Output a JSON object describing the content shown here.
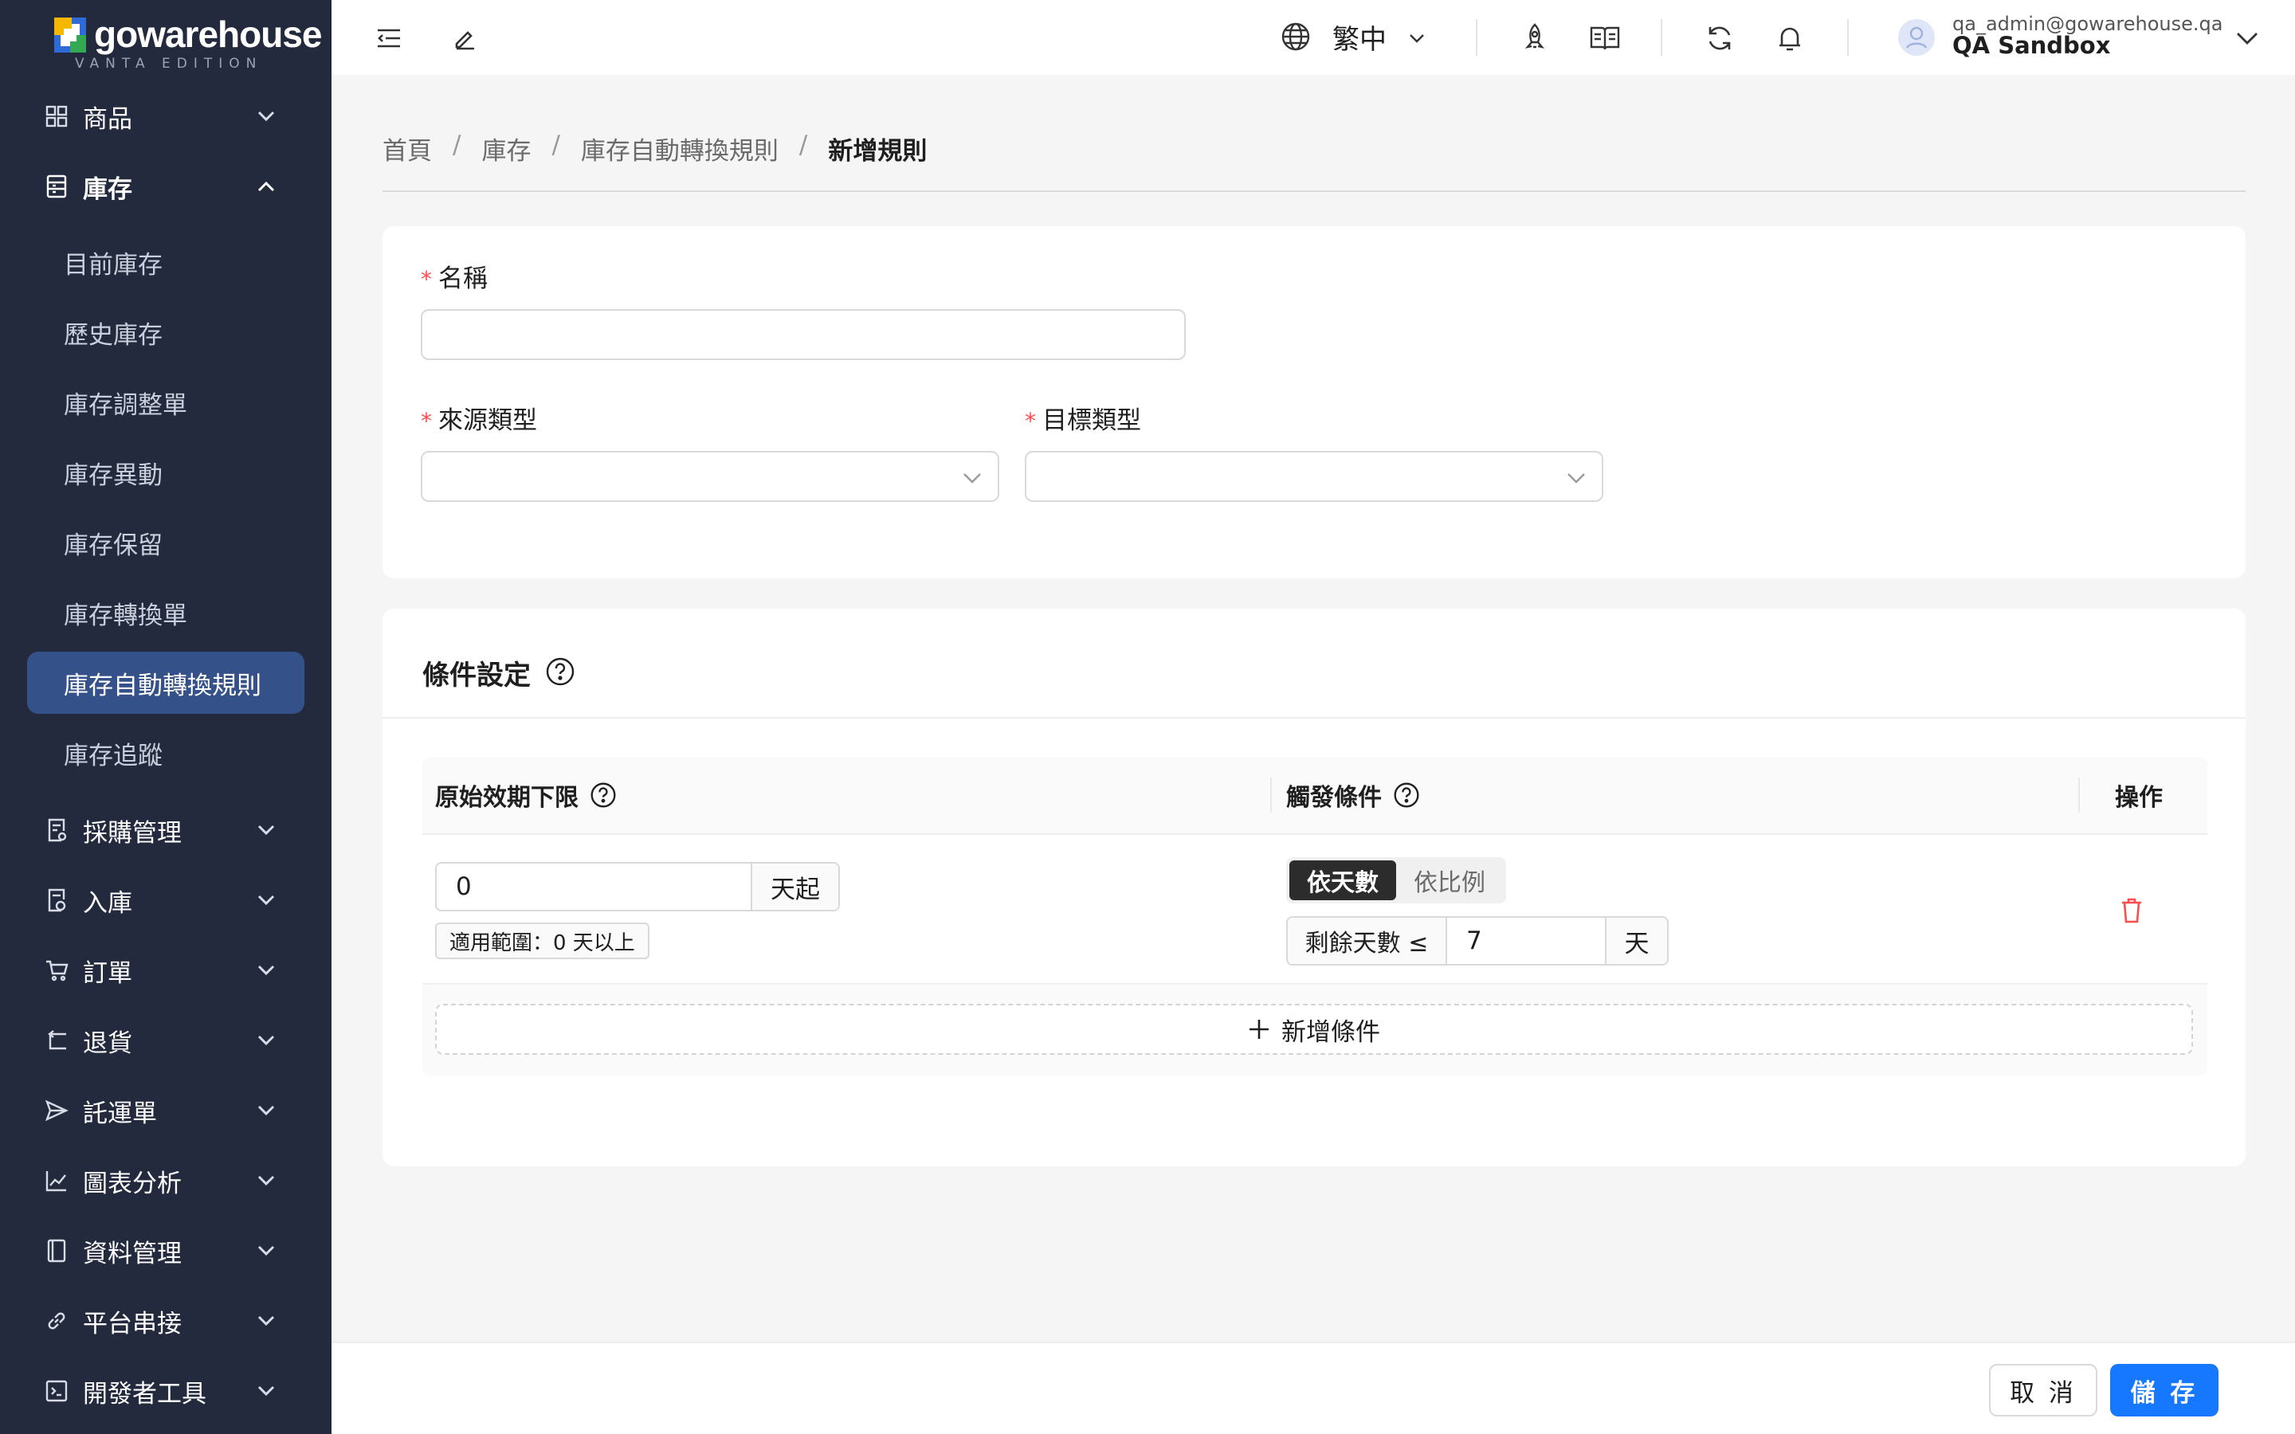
{
  "brand": {
    "name": "gowarehouse",
    "edition": "VANTA EDITION"
  },
  "sidebar": {
    "items": [
      {
        "label": "商品"
      },
      {
        "label": "庫存"
      },
      {
        "label": "採購管理"
      },
      {
        "label": "入庫"
      },
      {
        "label": "訂單"
      },
      {
        "label": "退貨"
      },
      {
        "label": "託運單"
      },
      {
        "label": "圖表分析"
      },
      {
        "label": "資料管理"
      },
      {
        "label": "平台串接"
      },
      {
        "label": "開發者工具"
      }
    ],
    "inventory_sub": [
      {
        "label": "目前庫存"
      },
      {
        "label": "歷史庫存"
      },
      {
        "label": "庫存調整單"
      },
      {
        "label": "庫存異動"
      },
      {
        "label": "庫存保留"
      },
      {
        "label": "庫存轉換單"
      },
      {
        "label": "庫存自動轉換規則"
      },
      {
        "label": "庫存追蹤"
      }
    ]
  },
  "header": {
    "language": "繁中",
    "user_email": "qa_admin@gowarehouse.qa",
    "user_name": "QA Sandbox"
  },
  "breadcrumb": [
    "首頁",
    "庫存",
    "庫存自動轉換規則",
    "新增規則"
  ],
  "form": {
    "name_label": "名稱",
    "name_value": "",
    "source_type_label": "來源類型",
    "target_type_label": "目標類型"
  },
  "conditions": {
    "title": "條件設定",
    "col_expiry": "原始效期下限",
    "col_trigger": "觸發條件",
    "col_action": "操作",
    "expiry_value": "0",
    "expiry_suffix": "天起",
    "range_tag": "適用範圍：0 天以上",
    "mode_days": "依天數",
    "mode_ratio": "依比例",
    "remaining_prefix": "剩餘天數 ≤",
    "remaining_value": "7",
    "remaining_suffix": "天",
    "add_condition": "新增條件"
  },
  "footer": {
    "cancel": "取 消",
    "save": "儲 存"
  },
  "colors": {
    "sidebar_bg": "#232a3d",
    "active_item": "#34518a",
    "primary": "#1677ff",
    "danger": "#ff4d4f"
  }
}
